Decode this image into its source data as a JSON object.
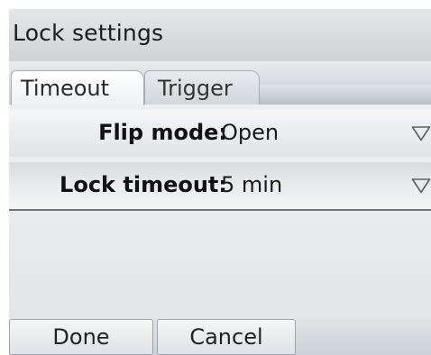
{
  "header": {
    "title": "Lock settings"
  },
  "tabs": [
    {
      "label": "Timeout",
      "active": true
    },
    {
      "label": "Trigger",
      "active": false
    }
  ],
  "settings": [
    {
      "label": "Flip mode:",
      "value": "Open",
      "icon": "dropdown-triangle-icon"
    },
    {
      "label": "Lock timeout:",
      "value": "5 min",
      "icon": "dropdown-triangle-icon"
    }
  ],
  "softkeys": {
    "done_label": "Done",
    "cancel_label": "Cancel"
  },
  "colors": {
    "divider": "#6d7378",
    "text": "#1a1a1a"
  }
}
